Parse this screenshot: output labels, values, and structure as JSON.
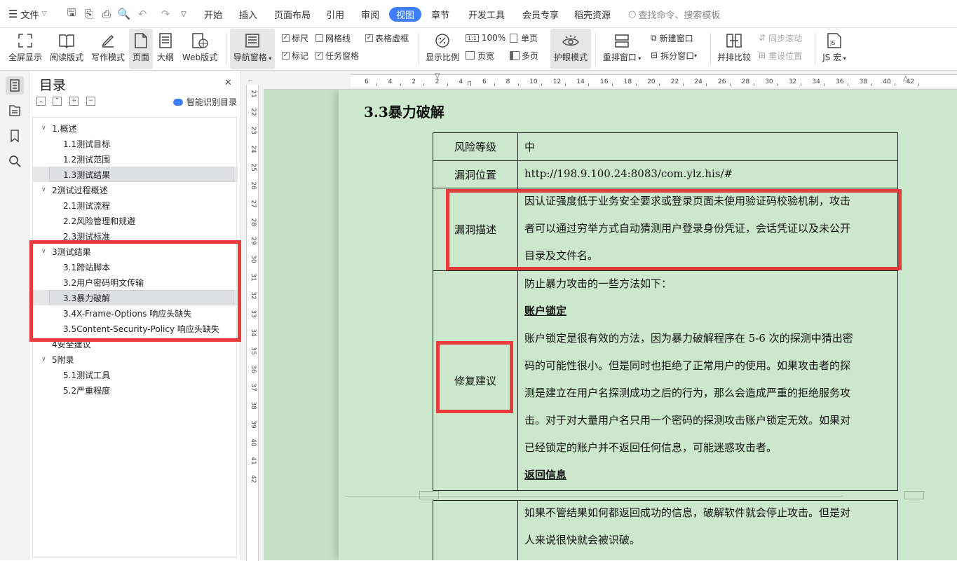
{
  "menubar": {
    "file_label": "文件",
    "tabs": [
      "开始",
      "插入",
      "页面布局",
      "引用",
      "审阅",
      "视图",
      "章节",
      "开发工具",
      "会员专享",
      "稻壳资源"
    ],
    "active_tab": "视图",
    "search_placeholder": "查找命令、搜索模板"
  },
  "ribbon": {
    "fullscreen": "全屏显示",
    "reading": "阅读版式",
    "writing": "写作模式",
    "page": "页面",
    "outline": "大纲",
    "web": "Web版式",
    "nav_pane": "导航窗格",
    "ruler": "标尺",
    "gridlines": "网格线",
    "table_gridlines": "表格虚框",
    "marks": "标记",
    "task_pane": "任务窗格",
    "zoom": "显示比例",
    "zoom_100": "100%",
    "page_width": "页宽",
    "single_page": "单页",
    "multi_page": "多页",
    "eye_protection": "护眼模式",
    "arrange_window": "重排窗口",
    "new_window": "新建窗口",
    "split_window": "拆分窗口",
    "side_by_side": "并排比较",
    "sync_scroll": "同步滚动",
    "reset_position": "重设位置",
    "js_macro": "JS 宏"
  },
  "toc": {
    "title": "目录",
    "smart_label": "智能识别目录",
    "items": [
      {
        "label": "1.概述",
        "level": 1,
        "expanded": true
      },
      {
        "label": "1.1测试目标",
        "level": 2
      },
      {
        "label": "1.2测试范围",
        "level": 2
      },
      {
        "label": "1.3测试结果",
        "level": 2,
        "selected": true
      },
      {
        "label": "2测试过程概述",
        "level": 1,
        "expanded": true
      },
      {
        "label": "2.1测试流程",
        "level": 2
      },
      {
        "label": "2.2风险管理和规避",
        "level": 2
      },
      {
        "label": "2.3测试标准",
        "level": 2
      },
      {
        "label": "3测试结果",
        "level": 1,
        "expanded": true
      },
      {
        "label": "3.1跨站脚本",
        "level": 2
      },
      {
        "label": "3.2用户密码明文传输",
        "level": 2
      },
      {
        "label": "3.3暴力破解",
        "level": 2,
        "selected": true
      },
      {
        "label": "3.4X-Frame-Options 响应头缺失",
        "level": 2
      },
      {
        "label": "3.5Content-Security-Policy 响应头缺失",
        "level": 2
      },
      {
        "label": "4安全建议",
        "level": 1
      },
      {
        "label": "5附录",
        "level": 1,
        "expanded": true
      },
      {
        "label": "5.1测试工具",
        "level": 2
      },
      {
        "label": "5.2严重程度",
        "level": 2
      }
    ]
  },
  "vruler": {
    "numbers": [
      "21",
      "22",
      "23",
      "24",
      "25",
      "26",
      "27",
      "28",
      "29",
      "30",
      "31",
      "32",
      "33",
      "34",
      "35",
      "36",
      "37",
      "38",
      "39",
      "40",
      "41",
      "42"
    ]
  },
  "hruler": {
    "numbers": [
      "6",
      "4",
      "2",
      "2",
      "4",
      "6",
      "8",
      "10",
      "12",
      "14",
      "16",
      "18",
      "20",
      "22",
      "24",
      "26",
      "28",
      "30",
      "32",
      "34",
      "36",
      "38",
      "40",
      "42"
    ]
  },
  "document": {
    "heading": "3.3暴力破解",
    "risk_label": "风险等级",
    "risk_value": "中",
    "location_label": "漏洞位置",
    "location_value": "http://198.9.100.24:8083/com.ylz.his/#",
    "desc_label": "漏洞描述",
    "desc_lines": [
      "因认证强度低于业务安全要求或登录页面未使用验证码校验机制，攻击",
      "者可以通过穷举方式自动猜测用户登录身份凭证，会话凭证以及未公开",
      "目录及文件名。"
    ],
    "fix_label": "修复建议",
    "fix_intro": "防止暴力攻击的一些方法如下：",
    "fix_sub1": "账户锁定",
    "fix_lines": [
      "账户锁定是很有效的方法，因为暴力破解程序在 5-6 次的探测中猜出密",
      "码的可能性很小。但是同时也拒绝了正常用户的使用。如果攻击者的探",
      "测是建立在用户名探测成功之后的行为，那么会造成严重的拒绝服务攻",
      "击。对于对大量用户名只用一个密码的探测攻击账户锁定无效。如果对",
      "已经锁定的账户并不返回任何信息，可能迷惑攻击者。"
    ],
    "fix_sub2": "返回信息",
    "next_lines": [
      "如果不管结果如何都返回成功的信息，破解软件就会停止攻击。但是对",
      "人来说很快就会被识破。"
    ]
  },
  "colors": {
    "accent": "#3d7eff",
    "doc_bg": "#cce8cc",
    "highlight_box": "#e83b3b"
  }
}
